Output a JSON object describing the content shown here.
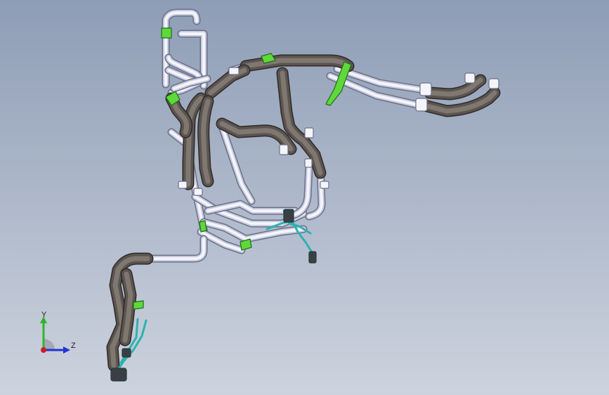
{
  "viewport": {
    "background_top": "#8e9db6",
    "background_bottom": "#cdd3de"
  },
  "model": {
    "colors": {
      "white_pipe": "#f4f5fb",
      "white_pipe_edge": "#6c7186",
      "white_pipe_shade": "#c8cbe0",
      "insulated_pipe": "#7f7770",
      "insulated_pipe_edge": "#2f2a27",
      "insulated_pipe_shade": "#5b5450",
      "bracket_green": "#5ed83a",
      "bracket_green_edge": "#1f6e18",
      "cable_teal": "#2bb3b0",
      "cable_edge": "#1f3f3e",
      "connector_dark": "#3a3f44"
    }
  },
  "triad": {
    "y_label": "Y",
    "z_label": "Z",
    "colors": {
      "y_axis": "#2fb52b",
      "z_axis": "#2134d4",
      "x_origin": "#cc1f1f",
      "arc": "#9aa0ab"
    }
  }
}
